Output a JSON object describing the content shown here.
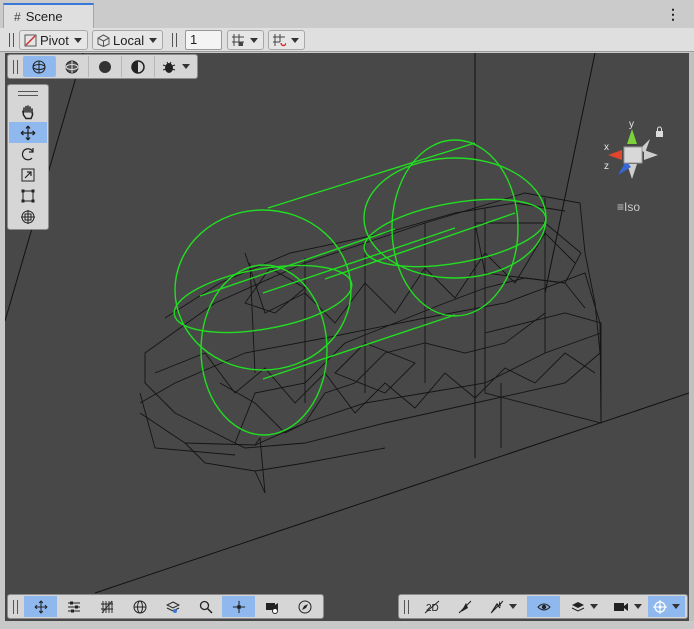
{
  "tab": {
    "title": "Scene",
    "icon": "hash-grid-icon"
  },
  "menu": {
    "icon": "kebab-menu-icon",
    "glyph": "⋮"
  },
  "toolbar": {
    "pivot_label": "Pivot",
    "local_label": "Local",
    "grid_size_value": "1"
  },
  "orientation": {
    "view_label": "Iso",
    "x_label": "x",
    "y_label": "y",
    "z_label": "z"
  },
  "colors": {
    "accent": "#3a79d8",
    "active_button": "#8fb8ef",
    "viewport": "#484848",
    "wireframe_green": "#22dd22"
  }
}
